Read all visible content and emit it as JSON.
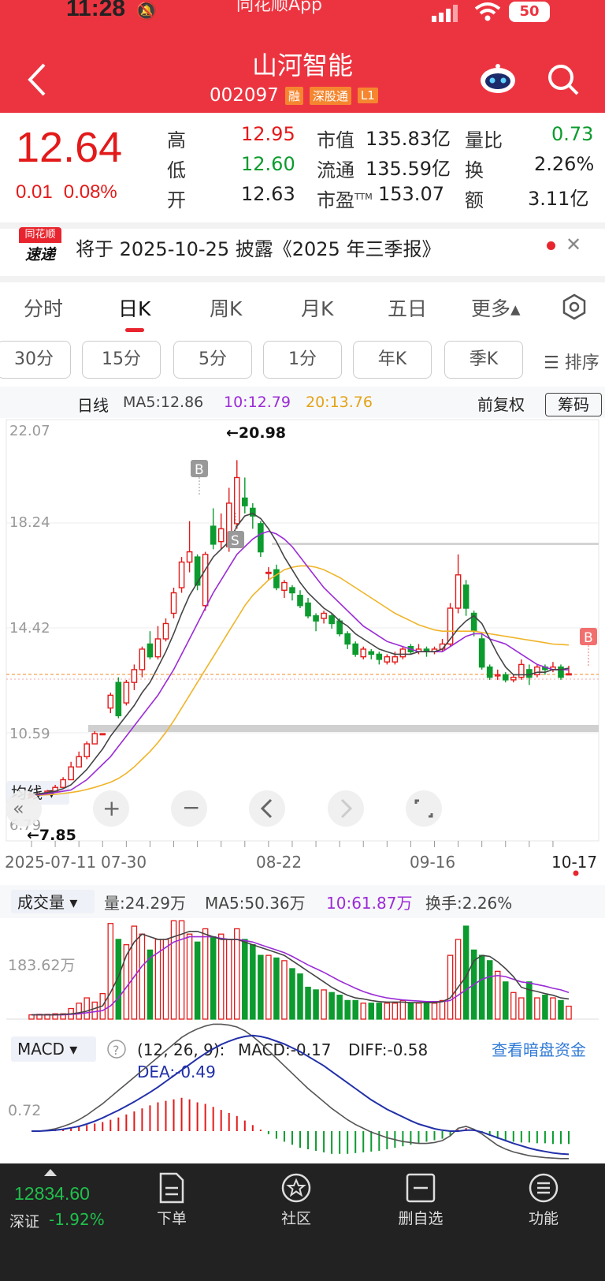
{
  "status": {
    "time": "11:28",
    "app": "同花顺App",
    "battery": "50"
  },
  "header": {
    "title": "山河智能",
    "code": "002097",
    "tags": [
      "融",
      "深股通",
      "L1"
    ]
  },
  "quote": {
    "price": "12.64",
    "change": "0.01",
    "change_pct": "0.08%",
    "high_label": "高",
    "high": "12.95",
    "low_label": "低",
    "low": "12.60",
    "open_label": "开",
    "open": "12.63",
    "mcap_label": "市值",
    "mcap": "135.83亿",
    "float_label": "流通",
    "float": "135.59亿",
    "pe_label": "市盈",
    "pe_sup": "TTM",
    "pe": "153.07",
    "vr_label": "量比",
    "vr": "0.73",
    "turn_label": "换",
    "turn": "2.26%",
    "amt_label": "额",
    "amt": "3.11亿"
  },
  "notice": {
    "brand_top": "同花顺",
    "brand_bottom": "速递",
    "text": "将于 2025-10-25 披露《2025 年三季报》"
  },
  "tabs": [
    "分时",
    "日K",
    "周K",
    "月K",
    "五日",
    "更多▴"
  ],
  "period_tabs": [
    "30分",
    "15分",
    "5分",
    "1分",
    "年K",
    "季K"
  ],
  "sort_label": "☰ 排序",
  "kline_legend": {
    "selector": "均线 ▾",
    "type": "日线",
    "ma5": "MA5:12.86",
    "ma10": "10:12.79",
    "ma20": "20:13.76",
    "adjust": "前复权",
    "chips": "筹码"
  },
  "kline_axis": {
    "y_labels": [
      "22.07",
      "18.24",
      "14.42",
      "10.59",
      "6.79"
    ],
    "x_labels": [
      "2025-07-11",
      "07-30",
      "08-22",
      "09-16",
      "10-17"
    ],
    "high_label": "←20.98",
    "low_label": "←7.85"
  },
  "volume_legend": {
    "selector": "成交量 ▾",
    "vol": "量:24.29万",
    "ma5": "MA5:50.36万",
    "ma10": "10:61.87万",
    "turn": "换手:2.26%",
    "y_label": "183.62万"
  },
  "macd_legend": {
    "selector": "MACD ▾",
    "params": "(12, 26, 9):",
    "macd": "MACD:-0.17",
    "diff": "DIFF:-0.58",
    "dea": "DEA:-0.49",
    "link": "查看暗盘资金",
    "y_label": "0.72"
  },
  "bottom": {
    "index_value": "12834.60",
    "index_name": "深证",
    "index_pct": "-1.92%",
    "nav": [
      "下单",
      "社区",
      "删自选",
      "功能"
    ]
  },
  "colors": {
    "header": "#ec3440",
    "up": "#e31a1a",
    "down": "#0c9b2e",
    "ma5": "#444444",
    "ma10": "#9b2bd6",
    "ma20": "#f0b429",
    "dea": "#2230a8"
  },
  "chart_data": [
    {
      "type": "candlestick",
      "title": "日线",
      "ylim": [
        6.79,
        22.07
      ],
      "x_start": "2025-07-11",
      "x_end": "10-17",
      "candles": [
        {
          "open": 7.85,
          "close": 7.9,
          "high": 8.0,
          "low": 7.85
        },
        {
          "open": 7.9,
          "close": 7.95,
          "high": 8.0,
          "low": 7.9
        },
        {
          "open": 7.95,
          "close": 8.05,
          "high": 8.1,
          "low": 7.95
        },
        {
          "open": 8.05,
          "close": 8.2,
          "high": 8.3,
          "low": 8.0
        },
        {
          "open": 8.2,
          "close": 8.5,
          "high": 8.6,
          "low": 8.2
        },
        {
          "open": 8.5,
          "close": 9.0,
          "high": 9.2,
          "low": 8.5
        },
        {
          "open": 9.0,
          "close": 9.4,
          "high": 9.6,
          "low": 9.0
        },
        {
          "open": 9.4,
          "close": 9.9,
          "high": 10.0,
          "low": 9.3
        },
        {
          "open": 9.9,
          "close": 10.3,
          "high": 10.4,
          "low": 9.9
        },
        {
          "open": 10.3,
          "close": 10.3,
          "high": 10.3,
          "low": 10.3
        },
        {
          "open": 11.3,
          "close": 11.8,
          "high": 11.9,
          "low": 11.1
        },
        {
          "open": 12.3,
          "close": 11.0,
          "high": 12.5,
          "low": 10.9
        },
        {
          "open": 11.5,
          "close": 12.3,
          "high": 12.4,
          "low": 11.4
        },
        {
          "open": 12.3,
          "close": 12.8,
          "high": 13.0,
          "low": 12.0
        },
        {
          "open": 12.8,
          "close": 13.6,
          "high": 13.7,
          "low": 12.5
        },
        {
          "open": 13.8,
          "close": 13.3,
          "high": 14.3,
          "low": 13.2
        },
        {
          "open": 13.3,
          "close": 14.0,
          "high": 14.5,
          "low": 13.2
        },
        {
          "open": 14.0,
          "close": 14.6,
          "high": 14.8,
          "low": 13.9
        },
        {
          "open": 15.0,
          "close": 15.8,
          "high": 16.0,
          "low": 14.8
        },
        {
          "open": 16.0,
          "close": 17.0,
          "high": 17.2,
          "low": 15.8
        },
        {
          "open": 17.0,
          "close": 17.4,
          "high": 18.6,
          "low": 16.6
        },
        {
          "open": 17.2,
          "close": 16.1,
          "high": 17.3,
          "low": 15.9
        },
        {
          "open": 15.3,
          "close": 17.3,
          "high": 17.4,
          "low": 15.1
        },
        {
          "open": 18.4,
          "close": 17.7,
          "high": 19.1,
          "low": 17.5
        },
        {
          "open": 17.8,
          "close": 18.3,
          "high": 18.9,
          "low": 17.5
        },
        {
          "open": 17.6,
          "close": 19.3,
          "high": 19.9,
          "low": 17.4
        },
        {
          "open": 18.5,
          "close": 20.3,
          "high": 20.98,
          "low": 18.3
        },
        {
          "open": 19.5,
          "close": 19.2,
          "high": 20.3,
          "low": 18.9
        },
        {
          "open": 19.1,
          "close": 18.8,
          "high": 19.3,
          "low": 18.3
        },
        {
          "open": 18.5,
          "close": 17.4,
          "high": 18.6,
          "low": 17.2
        },
        {
          "open": 16.6,
          "close": 16.6,
          "high": 16.8,
          "low": 16.3
        },
        {
          "open": 16.7,
          "close": 16.0,
          "high": 16.9,
          "low": 15.9
        },
        {
          "open": 15.9,
          "close": 16.2,
          "high": 16.3,
          "low": 15.6
        },
        {
          "open": 16.0,
          "close": 15.8,
          "high": 16.1,
          "low": 15.5
        },
        {
          "open": 15.7,
          "close": 15.3,
          "high": 15.9,
          "low": 15.2
        },
        {
          "open": 15.4,
          "close": 14.9,
          "high": 15.6,
          "low": 14.8
        },
        {
          "open": 14.9,
          "close": 14.7,
          "high": 15.0,
          "low": 14.3
        },
        {
          "open": 14.8,
          "close": 15.0,
          "high": 15.1,
          "low": 14.6
        },
        {
          "open": 14.9,
          "close": 14.6,
          "high": 15.0,
          "low": 14.4
        },
        {
          "open": 14.7,
          "close": 14.2,
          "high": 14.8,
          "low": 14.1
        },
        {
          "open": 14.2,
          "close": 13.8,
          "high": 14.3,
          "low": 13.6
        },
        {
          "open": 13.8,
          "close": 13.4,
          "high": 13.9,
          "low": 13.3
        },
        {
          "open": 13.3,
          "close": 13.6,
          "high": 13.7,
          "low": 13.2
        },
        {
          "open": 13.5,
          "close": 13.4,
          "high": 13.6,
          "low": 13.2
        },
        {
          "open": 13.4,
          "close": 13.2,
          "high": 13.5,
          "low": 13.0
        },
        {
          "open": 13.1,
          "close": 13.3,
          "high": 13.4,
          "low": 13.0
        },
        {
          "open": 13.1,
          "close": 13.3,
          "high": 13.5,
          "low": 13.0
        },
        {
          "open": 13.3,
          "close": 13.6,
          "high": 13.7,
          "low": 13.2
        },
        {
          "open": 13.7,
          "close": 13.5,
          "high": 13.8,
          "low": 13.4
        },
        {
          "open": 13.5,
          "close": 13.6,
          "high": 13.8,
          "low": 13.4
        },
        {
          "open": 13.6,
          "close": 13.5,
          "high": 13.7,
          "low": 13.3
        },
        {
          "open": 13.5,
          "close": 13.6,
          "high": 13.7,
          "low": 13.4
        },
        {
          "open": 13.6,
          "close": 13.8,
          "high": 14.0,
          "low": 13.5
        },
        {
          "open": 13.8,
          "close": 15.2,
          "high": 15.4,
          "low": 13.7
        },
        {
          "open": 15.2,
          "close": 16.5,
          "high": 17.3,
          "low": 15.0
        },
        {
          "open": 16.1,
          "close": 15.2,
          "high": 16.3,
          "low": 14.9
        },
        {
          "open": 15.0,
          "close": 14.3,
          "high": 15.1,
          "low": 14.1
        },
        {
          "open": 14.0,
          "close": 12.9,
          "high": 14.2,
          "low": 12.8
        },
        {
          "open": 12.9,
          "close": 12.5,
          "high": 13.0,
          "low": 12.4
        },
        {
          "open": 12.6,
          "close": 12.6,
          "high": 12.8,
          "low": 12.4
        },
        {
          "open": 12.6,
          "close": 12.4,
          "high": 12.7,
          "low": 12.3
        },
        {
          "open": 12.4,
          "close": 12.5,
          "high": 12.6,
          "low": 12.3
        },
        {
          "open": 12.5,
          "close": 13.0,
          "high": 13.2,
          "low": 12.4
        },
        {
          "open": 12.8,
          "close": 12.5,
          "high": 13.0,
          "low": 12.2
        },
        {
          "open": 12.6,
          "close": 12.9,
          "high": 13.0,
          "low": 12.5
        },
        {
          "open": 12.9,
          "close": 12.8,
          "high": 13.0,
          "low": 12.6
        },
        {
          "open": 12.8,
          "close": 12.9,
          "high": 13.1,
          "low": 12.7
        },
        {
          "open": 12.9,
          "close": 12.5,
          "high": 13.0,
          "low": 12.4
        },
        {
          "open": 12.63,
          "close": 12.64,
          "high": 12.95,
          "low": 12.6
        }
      ],
      "ma5": [
        7.9,
        7.95,
        8.0,
        8.05,
        8.15,
        8.3,
        8.6,
        8.9,
        9.3,
        9.7,
        10.2,
        10.6,
        11.0,
        11.4,
        11.9,
        12.3,
        12.9,
        13.5,
        14.2,
        15.0,
        15.7,
        16.2,
        16.7,
        17.2,
        17.5,
        17.8,
        18.4,
        18.8,
        18.9,
        18.7,
        18.3,
        17.8,
        17.2,
        16.7,
        16.2,
        15.8,
        15.5,
        15.2,
        15.0,
        14.7,
        14.5,
        14.2,
        14.0,
        13.8,
        13.6,
        13.5,
        13.4,
        13.4,
        13.4,
        13.5,
        13.5,
        13.5,
        13.6,
        14.0,
        14.4,
        14.7,
        14.9,
        14.6,
        14.0,
        13.4,
        12.9,
        12.6,
        12.6,
        12.6,
        12.7,
        12.7,
        12.8,
        12.8,
        12.86
      ],
      "ma10": [
        7.9,
        7.92,
        7.95,
        8.0,
        8.05,
        8.1,
        8.3,
        8.5,
        8.8,
        9.1,
        9.4,
        9.8,
        10.2,
        10.6,
        11.0,
        11.4,
        11.8,
        12.3,
        12.8,
        13.4,
        14.0,
        14.6,
        15.2,
        15.8,
        16.3,
        16.8,
        17.3,
        17.6,
        17.9,
        18.1,
        18.2,
        18.1,
        17.9,
        17.6,
        17.2,
        16.8,
        16.4,
        16.0,
        15.7,
        15.4,
        15.1,
        14.8,
        14.5,
        14.3,
        14.1,
        13.9,
        13.8,
        13.7,
        13.6,
        13.5,
        13.5,
        13.5,
        13.5,
        13.7,
        13.9,
        14.1,
        14.2,
        14.2,
        14.0,
        13.9,
        13.8,
        13.6,
        13.4,
        13.2,
        13.0,
        12.9,
        12.8,
        12.8,
        12.79
      ],
      "ma20": [
        7.9,
        7.9,
        7.91,
        7.93,
        7.96,
        8.0,
        8.05,
        8.12,
        8.2,
        8.3,
        8.4,
        8.55,
        8.75,
        9.0,
        9.3,
        9.6,
        9.95,
        10.35,
        10.8,
        11.3,
        11.8,
        12.3,
        12.8,
        13.3,
        13.8,
        14.3,
        14.8,
        15.3,
        15.7,
        16.0,
        16.3,
        16.5,
        16.7,
        16.8,
        16.85,
        16.85,
        16.8,
        16.7,
        16.55,
        16.4,
        16.2,
        16.0,
        15.8,
        15.6,
        15.4,
        15.2,
        15.0,
        14.85,
        14.7,
        14.55,
        14.45,
        14.35,
        14.3,
        14.3,
        14.3,
        14.3,
        14.3,
        14.25,
        14.2,
        14.15,
        14.1,
        14.05,
        14.0,
        13.95,
        13.9,
        13.85,
        13.8,
        13.78,
        13.76
      ]
    },
    {
      "type": "bar",
      "title": "成交量",
      "ylabel": "万",
      "volumes": [
        8,
        9,
        9,
        10,
        10,
        20,
        30,
        40,
        32,
        48,
        180,
        150,
        140,
        175,
        160,
        130,
        150,
        150,
        185,
        185,
        160,
        145,
        170,
        155,
        160,
        150,
        170,
        150,
        140,
        120,
        120,
        115,
        110,
        95,
        85,
        60,
        55,
        55,
        50,
        45,
        35,
        35,
        30,
        30,
        30,
        30,
        30,
        35,
        30,
        30,
        30,
        30,
        35,
        120,
        150,
        175,
        130,
        120,
        110,
        90,
        70,
        50,
        40,
        70,
        40,
        45,
        40,
        35,
        24.29
      ],
      "ma5": [
        8,
        8,
        8,
        8,
        9,
        10,
        12,
        15,
        20,
        25,
        50,
        80,
        120,
        145,
        160,
        155,
        150,
        150,
        155,
        160,
        165,
        165,
        160,
        155,
        150,
        150,
        150,
        145,
        140,
        135,
        130,
        125,
        120,
        110,
        100,
        90,
        80,
        70,
        60,
        52,
        45,
        40,
        38,
        35,
        33,
        32,
        32,
        32,
        31,
        31,
        31,
        31,
        33,
        40,
        60,
        80,
        110,
        120,
        118,
        108,
        95,
        80,
        60,
        55,
        52,
        48,
        45,
        40,
        38
      ],
      "ma10": [
        8,
        8,
        8,
        8,
        8,
        9,
        10,
        12,
        14,
        16,
        25,
        40,
        60,
        80,
        100,
        115,
        125,
        135,
        145,
        150,
        155,
        155,
        155,
        155,
        152,
        150,
        150,
        148,
        145,
        140,
        135,
        130,
        125,
        118,
        110,
        102,
        95,
        88,
        80,
        72,
        65,
        58,
        52,
        47,
        43,
        40,
        38,
        36,
        35,
        34,
        33,
        33,
        33,
        35,
        45,
        55,
        65,
        75,
        80,
        82,
        80,
        75,
        70,
        68,
        65,
        62,
        58,
        55,
        50
      ]
    },
    {
      "type": "bar",
      "title": "MACD",
      "macd": [
        0,
        0,
        0,
        0.01,
        0.02,
        0.04,
        0.06,
        0.08,
        0.1,
        0.12,
        0.15,
        0.18,
        0.22,
        0.26,
        0.3,
        0.34,
        0.38,
        0.4,
        0.42,
        0.44,
        0.42,
        0.38,
        0.36,
        0.32,
        0.28,
        0.24,
        0.2,
        0.14,
        0.08,
        0.02,
        -0.04,
        -0.1,
        -0.14,
        -0.18,
        -0.22,
        -0.24,
        -0.26,
        -0.28,
        -0.3,
        -0.3,
        -0.3,
        -0.29,
        -0.28,
        -0.27,
        -0.26,
        -0.24,
        -0.22,
        -0.2,
        -0.18,
        -0.16,
        -0.14,
        -0.12,
        -0.1,
        -0.06,
        0.02,
        0.04,
        0.02,
        -0.02,
        -0.06,
        -0.1,
        -0.12,
        -0.14,
        -0.15,
        -0.15,
        -0.16,
        -0.16,
        -0.17,
        -0.17,
        -0.17
      ],
      "diff": [
        0,
        0,
        0.02,
        0.05,
        0.1,
        0.16,
        0.24,
        0.34,
        0.46,
        0.58,
        0.72,
        0.86,
        1.0,
        1.14,
        1.28,
        1.42,
        1.56,
        1.7,
        1.84,
        1.98,
        2.08,
        2.16,
        2.22,
        2.26,
        2.26,
        2.24,
        2.2,
        2.12,
        2.0,
        1.86,
        1.7,
        1.54,
        1.38,
        1.22,
        1.06,
        0.9,
        0.76,
        0.62,
        0.48,
        0.36,
        0.24,
        0.14,
        0.06,
        -0.02,
        -0.08,
        -0.14,
        -0.18,
        -0.22,
        -0.24,
        -0.26,
        -0.26,
        -0.24,
        -0.2,
        -0.1,
        0.06,
        0.1,
        0.04,
        -0.06,
        -0.18,
        -0.3,
        -0.38,
        -0.44,
        -0.48,
        -0.52,
        -0.54,
        -0.56,
        -0.57,
        -0.58,
        -0.58
      ],
      "dea": [
        0,
        0,
        0.01,
        0.02,
        0.04,
        0.07,
        0.1,
        0.15,
        0.21,
        0.28,
        0.36,
        0.44,
        0.53,
        0.62,
        0.72,
        0.82,
        0.93,
        1.05,
        1.17,
        1.29,
        1.41,
        1.53,
        1.64,
        1.74,
        1.83,
        1.9,
        1.96,
        2.0,
        2.02,
        2.0,
        1.96,
        1.9,
        1.84,
        1.76,
        1.68,
        1.58,
        1.48,
        1.38,
        1.26,
        1.14,
        1.02,
        0.9,
        0.78,
        0.66,
        0.56,
        0.46,
        0.38,
        0.3,
        0.22,
        0.15,
        0.1,
        0.05,
        0.02,
        0.0,
        0.0,
        0.02,
        0.02,
        -0.02,
        -0.08,
        -0.14,
        -0.2,
        -0.26,
        -0.31,
        -0.36,
        -0.4,
        -0.43,
        -0.46,
        -0.48,
        -0.49
      ]
    }
  ]
}
